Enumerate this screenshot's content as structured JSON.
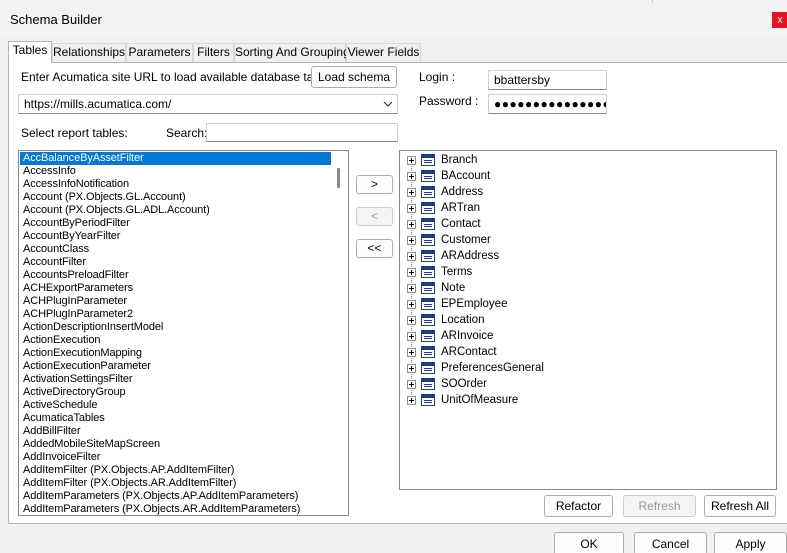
{
  "window": {
    "title": "Schema Builder",
    "close_glyph": "x"
  },
  "tabs": [
    {
      "label": "Tables",
      "active": true
    },
    {
      "label": "Relationships"
    },
    {
      "label": "Parameters"
    },
    {
      "label": "Filters"
    },
    {
      "label": "Sorting And Grouping"
    },
    {
      "label": "Viewer Fields"
    }
  ],
  "site": {
    "prompt": "Enter Acumatica site URL to load available database tables:",
    "load_button": "Load schema",
    "url": "https://mills.acumatica.com/"
  },
  "login": {
    "login_label": "Login :",
    "login_value": "bbattersby",
    "password_label": "Password :",
    "password_mask": "●●●●●●●●●●●●●●●"
  },
  "tables": {
    "select_label": "Select report tables:",
    "search_label": "Search:",
    "search_value": "",
    "items": [
      "AccBalanceByAssetFilter",
      "AccessInfo",
      "AccessInfoNotification",
      "Account (PX.Objects.GL.Account)",
      "Account (PX.Objects.GL.ADL.Account)",
      "AccountByPeriodFilter",
      "AccountByYearFilter",
      "AccountClass",
      "AccountFilter",
      "AccountsPreloadFilter",
      "ACHExportParameters",
      "ACHPlugInParameter",
      "ACHPlugInParameter2",
      "ActionDescriptionInsertModel",
      "ActionExecution",
      "ActionExecutionMapping",
      "ActionExecutionParameter",
      "ActivationSettingsFilter",
      "ActiveDirectoryGroup",
      "ActiveSchedule",
      "AcumaticaTables",
      "AddBillFilter",
      "AddedMobileSiteMapScreen",
      "AddInvoiceFilter",
      "AddItemFilter (PX.Objects.AP.AddItemFilter)",
      "AddItemFilter (PX.Objects.AR.AddItemFilter)",
      "AddItemParameters (PX.Objects.AP.AddItemParameters)",
      "AddItemParameters (PX.Objects.AR.AddItemParameters)"
    ],
    "selected_index": 0
  },
  "move_buttons": {
    "add": ">",
    "remove": "<",
    "remove_all": "<<"
  },
  "selected_tables": [
    "Branch",
    "BAccount",
    "Address",
    "ARTran",
    "Contact",
    "Customer",
    "ARAddress",
    "Terms",
    "Note",
    "EPEmployee",
    "Location",
    "ARInvoice",
    "ARContact",
    "PreferencesGeneral",
    "SOOrder",
    "UnitOfMeasure"
  ],
  "tree_buttons": {
    "refactor": "Refactor",
    "refresh": "Refresh",
    "refresh_all": "Refresh All"
  },
  "dialog_buttons": {
    "ok": "OK",
    "cancel": "Cancel",
    "apply": "Apply"
  },
  "icons": {
    "close": "close-icon",
    "dropdown": "chevron-down-icon",
    "expander": "expand-plus-icon",
    "table": "table-icon"
  }
}
